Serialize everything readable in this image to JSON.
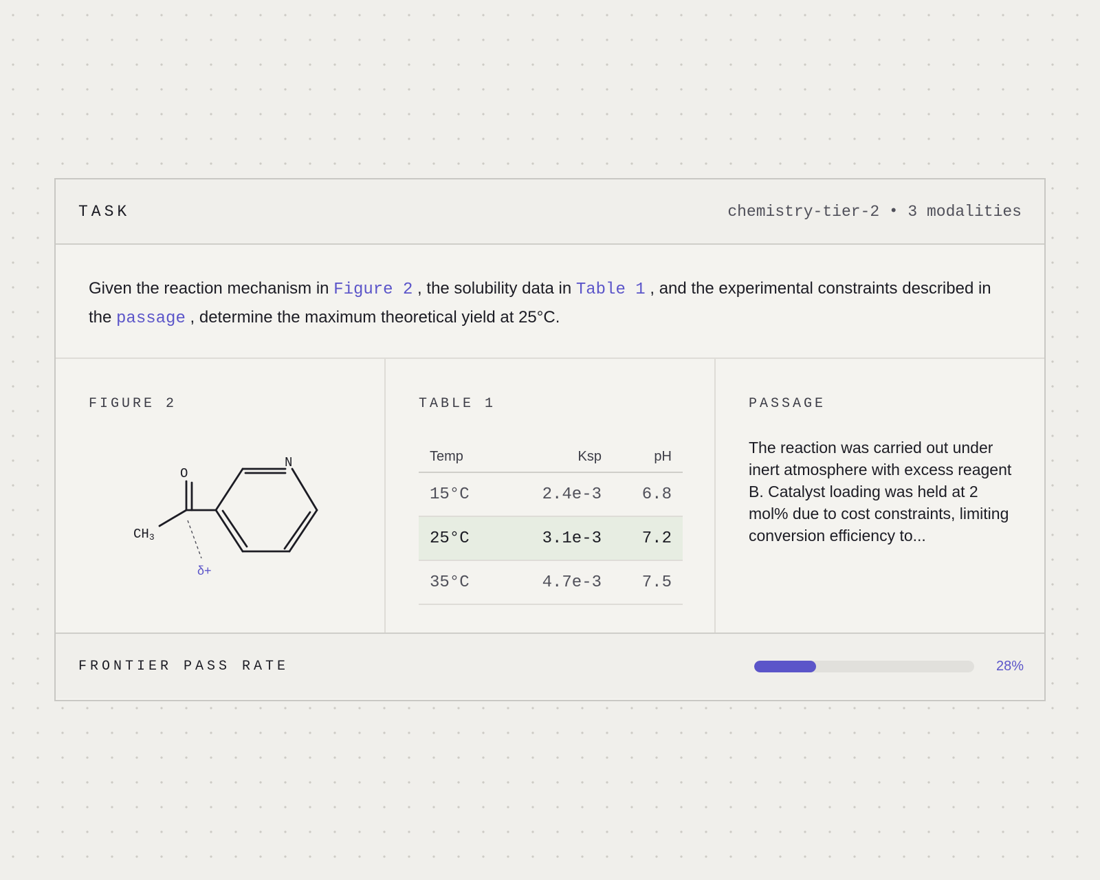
{
  "header": {
    "label": "TASK",
    "category": "chemistry-tier-2",
    "separator": "•",
    "modalities": "3 modalities"
  },
  "prompt": {
    "t1": "Given the reaction mechanism in ",
    "ref_figure": "Figure 2",
    "t2": " , the solubility data in ",
    "ref_table": "Table 1",
    "t3": " , and the experimental constraints described in the ",
    "ref_passage": "passage",
    "t4": " , determine the maximum theoretical yield at 25°C."
  },
  "figure": {
    "title": "FIGURE 2",
    "atom_o": "O",
    "atom_n": "N",
    "atom_ch3": "CH",
    "atom_ch3_sub": "3",
    "annotation": "δ+"
  },
  "table": {
    "title": "TABLE 1",
    "columns": [
      "Temp",
      "Ksp",
      "pH"
    ],
    "rows": [
      [
        "15°C",
        "2.4e-3",
        "6.8"
      ],
      [
        "25°C",
        "3.1e-3",
        "7.2"
      ],
      [
        "35°C",
        "4.7e-3",
        "7.5"
      ]
    ],
    "highlighted_row": 1
  },
  "passage": {
    "title": "PASSAGE",
    "text": "The reaction was carried out under inert atmosphere with excess reagent B. Catalyst loading was held at 2 mol% due to cost constraints, limiting conversion efficiency to..."
  },
  "footer": {
    "label": "FRONTIER PASS RATE",
    "pass_rate": 0.28,
    "pass_rate_label": "28%"
  },
  "colors": {
    "accent": "#5b55c9",
    "highlight_row": "#e7ede2",
    "background": "#f0efeb"
  }
}
